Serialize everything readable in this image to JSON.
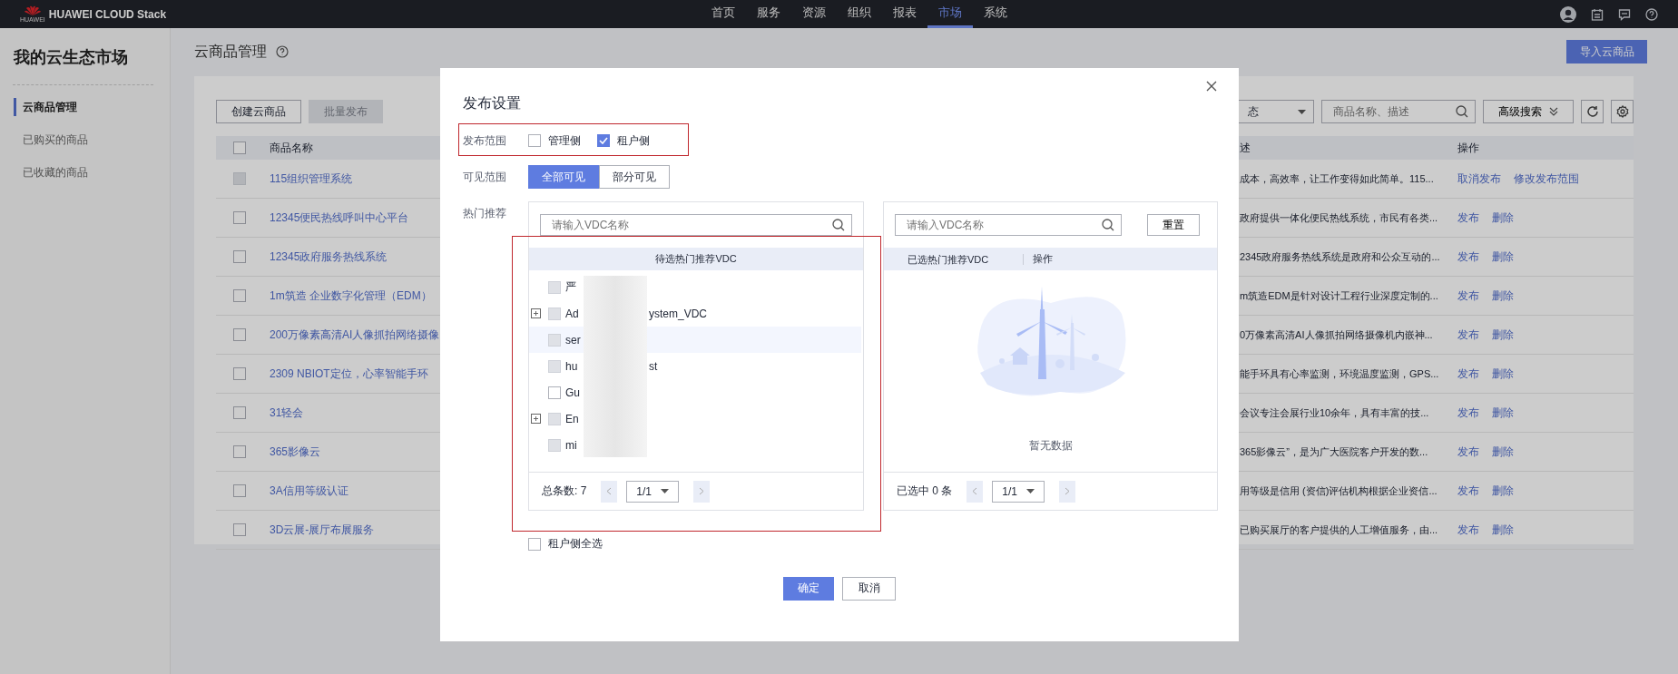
{
  "topbar": {
    "brand": "HUAWEI CLOUD Stack",
    "logo_caption": "HUAWEI",
    "nav": [
      {
        "label": "首页",
        "selected": false
      },
      {
        "label": "服务",
        "selected": false
      },
      {
        "label": "资源",
        "selected": false
      },
      {
        "label": "组织",
        "selected": false
      },
      {
        "label": "报表",
        "selected": false
      },
      {
        "label": "市场",
        "selected": true
      },
      {
        "label": "系统",
        "selected": false
      }
    ]
  },
  "sidebar": {
    "title": "我的云生态市场",
    "items": [
      {
        "label": "云商品管理",
        "selected": true
      },
      {
        "label": "已购买的商品",
        "selected": false
      },
      {
        "label": "已收藏的商品",
        "selected": false
      }
    ]
  },
  "page": {
    "title": "云商品管理",
    "import_button": "导入云商品"
  },
  "select_all_rows": {
    "checked": false
  },
  "toolbar": {
    "create_button": "创建云商品",
    "batch_button": {
      "label": "批量发布",
      "disabled": true
    },
    "status_filter": "态",
    "search_placeholder": "商品名称、描述",
    "advanced_search": "高级搜索"
  },
  "table": {
    "columns": [
      "商品名称",
      "述",
      "操作"
    ],
    "rows": [
      {
        "name": "115组织管理系统",
        "description": "成本，高效率，让工作变得如此简单。115...",
        "actions": [
          "取消发布",
          "修改发布范围"
        ],
        "disabled": true
      },
      {
        "name": "12345便民热线呼叫中心平台",
        "description": "政府提供一体化便民热线系统，市民有各类...",
        "actions": [
          "发布",
          "删除"
        ],
        "disabled": false
      },
      {
        "name": "12345政府服务热线系统",
        "description": "2345政府服务热线系统是政府和公众互动的...",
        "actions": [
          "发布",
          "删除"
        ],
        "disabled": false
      },
      {
        "name": "1m筑造 企业数字化管理（EDM）",
        "description": "m筑造EDM是针对设计工程行业深度定制的...",
        "actions": [
          "发布",
          "删除"
        ],
        "disabled": false
      },
      {
        "name": "200万像素高清AI人像抓拍网络摄像",
        "description": "0万像素高清AI人像抓拍网络摄像机内嵌神...",
        "actions": [
          "发布",
          "删除"
        ],
        "disabled": false
      },
      {
        "name": "2309 NBIOT定位，心率智能手环",
        "description": "能手环具有心率监测，环境温度监测，GPS...",
        "actions": [
          "发布",
          "删除"
        ],
        "disabled": false
      },
      {
        "name": "31轻会",
        "description": "会议专注会展行业10余年，具有丰富的技...",
        "actions": [
          "发布",
          "删除"
        ],
        "disabled": false
      },
      {
        "name": "365影像云",
        "description": "365影像云”，是为广大医院客户开发的数...",
        "actions": [
          "发布",
          "删除"
        ],
        "disabled": false
      },
      {
        "name": "3A信用等级认证",
        "description": "用等级是信用 (资信)评估机构根据企业资信...",
        "actions": [
          "发布",
          "删除"
        ],
        "disabled": false
      },
      {
        "name": "3D云展-展厅布展服务",
        "description": "已购买展厅的客户提供的人工增值服务，由...",
        "actions": [
          "发布",
          "删除"
        ],
        "disabled": false
      }
    ]
  },
  "dialog": {
    "title": "发布设置",
    "scope": {
      "label": "发布范围",
      "options": [
        {
          "label": "管理侧",
          "checked": false
        },
        {
          "label": "租户侧",
          "checked": true
        }
      ]
    },
    "visibility": {
      "label": "可见范围",
      "options": [
        {
          "label": "全部可见",
          "selected": true
        },
        {
          "label": "部分可见",
          "selected": false
        }
      ]
    },
    "recommend_label": "热门推荐",
    "source": {
      "search_placeholder": "请输入VDC名称",
      "header": "待选热门推荐VDC",
      "items": [
        {
          "text": "严",
          "expandable": false,
          "disabled": true,
          "highlighted": false
        },
        {
          "text": "Ad",
          "tail": "ystem_VDC",
          "expandable": true,
          "disabled": true,
          "highlighted": false
        },
        {
          "text": "ser",
          "expandable": false,
          "disabled": true,
          "highlighted": true
        },
        {
          "text": "hu",
          "tail": "st",
          "expandable": false,
          "disabled": true,
          "highlighted": false
        },
        {
          "text": "Gu",
          "expandable": false,
          "disabled": false,
          "highlighted": false
        },
        {
          "text": "En",
          "expandable": true,
          "disabled": true,
          "highlighted": false
        },
        {
          "text": "mi",
          "expandable": false,
          "disabled": true,
          "highlighted": false
        }
      ],
      "total": "总条数: 7",
      "page": "1/1"
    },
    "target": {
      "search_placeholder": "请输入VDC名称",
      "reset_button": "重置",
      "columns": [
        "已选热门推荐VDC",
        "操作"
      ],
      "empty_text": "暂无数据",
      "count": "已选中 0 条",
      "page": "1/1"
    },
    "select_all": {
      "label": "租户侧全选",
      "checked": false
    },
    "buttons": [
      {
        "label": "确定",
        "kind": "primary"
      },
      {
        "label": "取消",
        "kind": "secondary"
      }
    ]
  }
}
